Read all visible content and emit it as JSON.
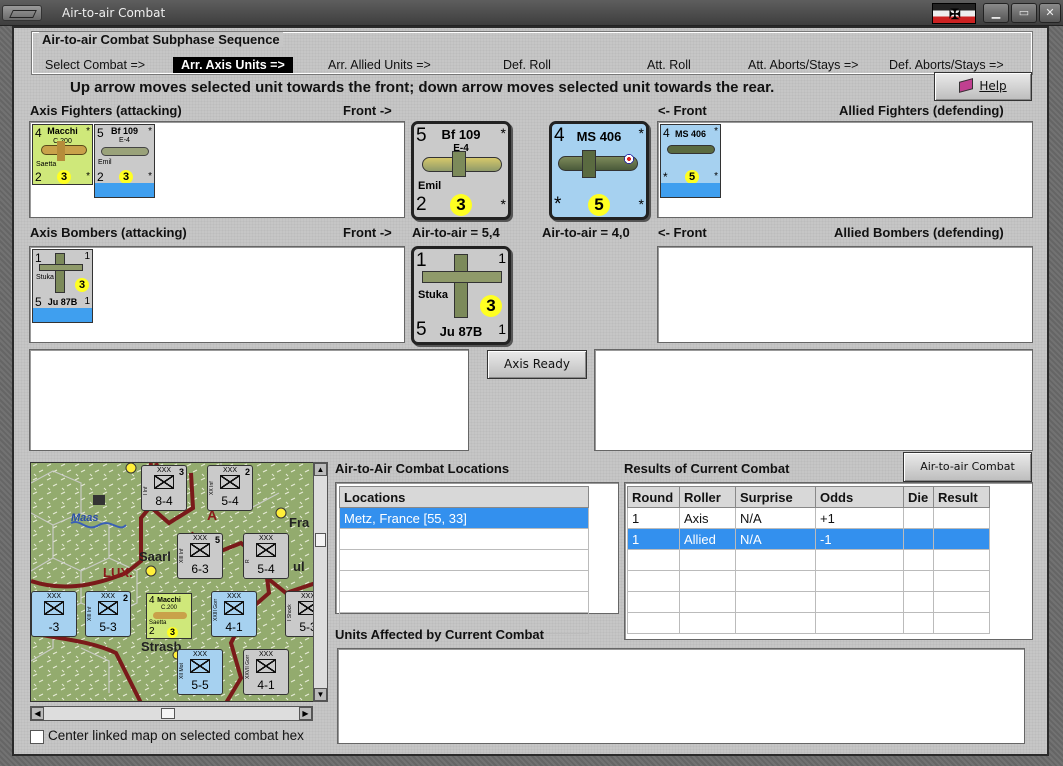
{
  "window": {
    "title": "Air-to-air Combat",
    "flag_symbol": "✠"
  },
  "sequence": {
    "title": "Air-to-air Combat Subphase Sequence",
    "steps": [
      "Select Combat =>",
      "Arr. Axis Units =>",
      "Arr. Allied Units =>",
      "Def. Roll",
      "Att. Roll",
      "Att. Aborts/Stays =>",
      "Def. Aborts/Stays =>"
    ],
    "active_index": 1
  },
  "instruction": "Up arrow moves selected unit towards the front; down arrow moves selected unit towards the rear.",
  "help_label": "Help",
  "labels": {
    "axis_fighters": "Axis Fighters (attacking)",
    "front_right": "Front ->",
    "front_left": "<- Front",
    "allied_fighters": "Allied Fighters (defending)",
    "axis_bombers": "Axis Bombers (attacking)",
    "allied_bombers": "Allied Bombers (defending)",
    "axis_ata": "Air-to-air = 5,4",
    "allied_ata": "Air-to-air = 4,0"
  },
  "axis_ready_label": "Axis Ready",
  "ata_chart_label": "Air-to-air Combat Chart",
  "units": {
    "macchi": {
      "tl": "4",
      "name": "Macchi",
      "sub": "C.200",
      "nick": "Saetta",
      "bl": "2",
      "rating": "3",
      "tr": "*",
      "br": "*"
    },
    "bf109_small": {
      "tl": "5",
      "name": "Bf 109",
      "sub": "E-4",
      "nick": "Emil",
      "bl": "2",
      "rating": "3",
      "tr": "*",
      "br": "*"
    },
    "bf109_big": {
      "tl": "5",
      "name": "Bf 109",
      "sub": "E-4",
      "nick": "Emil",
      "bl": "2",
      "rating": "3",
      "tr": "*",
      "br": "*"
    },
    "ms406_big": {
      "tl": "4",
      "name": "MS 406",
      "bl": "*",
      "rating": "5",
      "tr": "*",
      "br": "*"
    },
    "ms406_small": {
      "tl": "4",
      "name": "MS 406",
      "bl": "*",
      "rating": "5",
      "tr": "*",
      "br": "*"
    },
    "stuka_small": {
      "tl": "1",
      "tr": "1",
      "nick": "Stuka",
      "bl": "5",
      "name": "Ju 87B",
      "rating": "3",
      "br": "1"
    },
    "stuka_big": {
      "tl": "1",
      "tr": "1",
      "nick": "Stuka",
      "bl": "5",
      "name": "Ju 87B",
      "rating": "3",
      "br": "1"
    }
  },
  "map": {
    "labels": {
      "maas": "Maas",
      "saar": "Saarl",
      "lux": "LUX.",
      "strasb": "Strasb",
      "fra": "Fra",
      "ul": "ul",
      "big_a": "A"
    },
    "counters": [
      {
        "id": "c1",
        "top": "3",
        "strength": "8-4",
        "side": "I Inf"
      },
      {
        "id": "c2",
        "top": "2",
        "strength": "5-4",
        "side": "XX Inf"
      },
      {
        "id": "c3",
        "top": "5",
        "strength": "6-3",
        "side": "XIII Inf"
      },
      {
        "id": "c4",
        "top": "",
        "strength": "5-4",
        "side": "R"
      },
      {
        "id": "c5",
        "top": "2",
        "strength": "5-3",
        "side": "XIII Inf"
      },
      {
        "id": "c6",
        "top": "",
        "strength": "4-1",
        "side": "XXIII Gorr"
      },
      {
        "id": "c7",
        "top": "",
        "strength": "5-3",
        "side": "I Shock"
      },
      {
        "id": "c8",
        "top": "",
        "strength": "5-5",
        "side": "XII Mot"
      },
      {
        "id": "c9",
        "top": "",
        "strength": "4-1",
        "side": "XXVII Gorr"
      },
      {
        "id": "c10",
        "top": "",
        "strength": "-3",
        "side": ""
      }
    ],
    "counter_mark": "XXX",
    "macchi_counter": {
      "tl": "4",
      "name": "Macchi",
      "sub": "C.200",
      "nick": "Saetta",
      "bl": "2",
      "rating": "3"
    },
    "center_checkbox_label": "Center linked map on selected combat hex"
  },
  "locations": {
    "title": "Air-to-Air Combat Locations",
    "header": "Locations",
    "rows": [
      "Metz, France [55, 33]",
      "",
      "",
      "",
      "",
      ""
    ]
  },
  "results": {
    "title": "Results of Current Combat",
    "columns": [
      "Round",
      "Roller",
      "Surprise",
      "Odds",
      "Die",
      "Result"
    ],
    "rows": [
      [
        "1",
        "Axis",
        "N/A",
        "+1",
        "",
        ""
      ],
      [
        "1",
        "Allied",
        "N/A",
        "-1",
        "",
        ""
      ],
      [
        "",
        "",
        "",
        "",
        "",
        ""
      ],
      [
        "",
        "",
        "",
        "",
        "",
        ""
      ],
      [
        "",
        "",
        "",
        "",
        "",
        ""
      ],
      [
        "",
        "",
        "",
        "",
        "",
        ""
      ]
    ]
  },
  "units_affected_title": "Units Affected by Current Combat",
  "colors": {
    "selection": "#3390ee",
    "axis_counter": "#cacaca",
    "allied_counter": "#a6d1f0",
    "italian_counter": "#cfe87a",
    "rating_dot": "#ffff22"
  }
}
